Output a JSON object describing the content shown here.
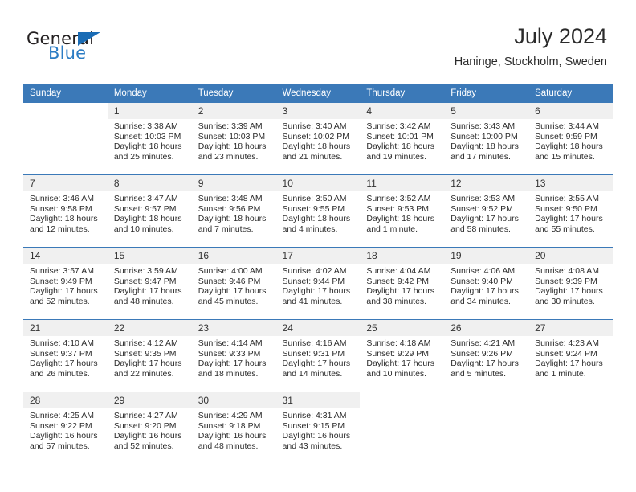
{
  "brand": {
    "name_dark": "General",
    "name_blue": "Blue",
    "accent_color": "#3b79b8"
  },
  "header": {
    "title": "July 2024",
    "subtitle": "Haninge, Stockholm, Sweden"
  },
  "calendar": {
    "weekday_headers": [
      "Sunday",
      "Monday",
      "Tuesday",
      "Wednesday",
      "Thursday",
      "Friday",
      "Saturday"
    ],
    "weeks": [
      [
        {
          "day": "",
          "sunrise": "",
          "sunset": "",
          "daylight1": "",
          "daylight2": ""
        },
        {
          "day": "1",
          "sunrise": "Sunrise: 3:38 AM",
          "sunset": "Sunset: 10:03 PM",
          "daylight1": "Daylight: 18 hours",
          "daylight2": "and 25 minutes."
        },
        {
          "day": "2",
          "sunrise": "Sunrise: 3:39 AM",
          "sunset": "Sunset: 10:03 PM",
          "daylight1": "Daylight: 18 hours",
          "daylight2": "and 23 minutes."
        },
        {
          "day": "3",
          "sunrise": "Sunrise: 3:40 AM",
          "sunset": "Sunset: 10:02 PM",
          "daylight1": "Daylight: 18 hours",
          "daylight2": "and 21 minutes."
        },
        {
          "day": "4",
          "sunrise": "Sunrise: 3:42 AM",
          "sunset": "Sunset: 10:01 PM",
          "daylight1": "Daylight: 18 hours",
          "daylight2": "and 19 minutes."
        },
        {
          "day": "5",
          "sunrise": "Sunrise: 3:43 AM",
          "sunset": "Sunset: 10:00 PM",
          "daylight1": "Daylight: 18 hours",
          "daylight2": "and 17 minutes."
        },
        {
          "day": "6",
          "sunrise": "Sunrise: 3:44 AM",
          "sunset": "Sunset: 9:59 PM",
          "daylight1": "Daylight: 18 hours",
          "daylight2": "and 15 minutes."
        }
      ],
      [
        {
          "day": "7",
          "sunrise": "Sunrise: 3:46 AM",
          "sunset": "Sunset: 9:58 PM",
          "daylight1": "Daylight: 18 hours",
          "daylight2": "and 12 minutes."
        },
        {
          "day": "8",
          "sunrise": "Sunrise: 3:47 AM",
          "sunset": "Sunset: 9:57 PM",
          "daylight1": "Daylight: 18 hours",
          "daylight2": "and 10 minutes."
        },
        {
          "day": "9",
          "sunrise": "Sunrise: 3:48 AM",
          "sunset": "Sunset: 9:56 PM",
          "daylight1": "Daylight: 18 hours",
          "daylight2": "and 7 minutes."
        },
        {
          "day": "10",
          "sunrise": "Sunrise: 3:50 AM",
          "sunset": "Sunset: 9:55 PM",
          "daylight1": "Daylight: 18 hours",
          "daylight2": "and 4 minutes."
        },
        {
          "day": "11",
          "sunrise": "Sunrise: 3:52 AM",
          "sunset": "Sunset: 9:53 PM",
          "daylight1": "Daylight: 18 hours",
          "daylight2": "and 1 minute."
        },
        {
          "day": "12",
          "sunrise": "Sunrise: 3:53 AM",
          "sunset": "Sunset: 9:52 PM",
          "daylight1": "Daylight: 17 hours",
          "daylight2": "and 58 minutes."
        },
        {
          "day": "13",
          "sunrise": "Sunrise: 3:55 AM",
          "sunset": "Sunset: 9:50 PM",
          "daylight1": "Daylight: 17 hours",
          "daylight2": "and 55 minutes."
        }
      ],
      [
        {
          "day": "14",
          "sunrise": "Sunrise: 3:57 AM",
          "sunset": "Sunset: 9:49 PM",
          "daylight1": "Daylight: 17 hours",
          "daylight2": "and 52 minutes."
        },
        {
          "day": "15",
          "sunrise": "Sunrise: 3:59 AM",
          "sunset": "Sunset: 9:47 PM",
          "daylight1": "Daylight: 17 hours",
          "daylight2": "and 48 minutes."
        },
        {
          "day": "16",
          "sunrise": "Sunrise: 4:00 AM",
          "sunset": "Sunset: 9:46 PM",
          "daylight1": "Daylight: 17 hours",
          "daylight2": "and 45 minutes."
        },
        {
          "day": "17",
          "sunrise": "Sunrise: 4:02 AM",
          "sunset": "Sunset: 9:44 PM",
          "daylight1": "Daylight: 17 hours",
          "daylight2": "and 41 minutes."
        },
        {
          "day": "18",
          "sunrise": "Sunrise: 4:04 AM",
          "sunset": "Sunset: 9:42 PM",
          "daylight1": "Daylight: 17 hours",
          "daylight2": "and 38 minutes."
        },
        {
          "day": "19",
          "sunrise": "Sunrise: 4:06 AM",
          "sunset": "Sunset: 9:40 PM",
          "daylight1": "Daylight: 17 hours",
          "daylight2": "and 34 minutes."
        },
        {
          "day": "20",
          "sunrise": "Sunrise: 4:08 AM",
          "sunset": "Sunset: 9:39 PM",
          "daylight1": "Daylight: 17 hours",
          "daylight2": "and 30 minutes."
        }
      ],
      [
        {
          "day": "21",
          "sunrise": "Sunrise: 4:10 AM",
          "sunset": "Sunset: 9:37 PM",
          "daylight1": "Daylight: 17 hours",
          "daylight2": "and 26 minutes."
        },
        {
          "day": "22",
          "sunrise": "Sunrise: 4:12 AM",
          "sunset": "Sunset: 9:35 PM",
          "daylight1": "Daylight: 17 hours",
          "daylight2": "and 22 minutes."
        },
        {
          "day": "23",
          "sunrise": "Sunrise: 4:14 AM",
          "sunset": "Sunset: 9:33 PM",
          "daylight1": "Daylight: 17 hours",
          "daylight2": "and 18 minutes."
        },
        {
          "day": "24",
          "sunrise": "Sunrise: 4:16 AM",
          "sunset": "Sunset: 9:31 PM",
          "daylight1": "Daylight: 17 hours",
          "daylight2": "and 14 minutes."
        },
        {
          "day": "25",
          "sunrise": "Sunrise: 4:18 AM",
          "sunset": "Sunset: 9:29 PM",
          "daylight1": "Daylight: 17 hours",
          "daylight2": "and 10 minutes."
        },
        {
          "day": "26",
          "sunrise": "Sunrise: 4:21 AM",
          "sunset": "Sunset: 9:26 PM",
          "daylight1": "Daylight: 17 hours",
          "daylight2": "and 5 minutes."
        },
        {
          "day": "27",
          "sunrise": "Sunrise: 4:23 AM",
          "sunset": "Sunset: 9:24 PM",
          "daylight1": "Daylight: 17 hours",
          "daylight2": "and 1 minute."
        }
      ],
      [
        {
          "day": "28",
          "sunrise": "Sunrise: 4:25 AM",
          "sunset": "Sunset: 9:22 PM",
          "daylight1": "Daylight: 16 hours",
          "daylight2": "and 57 minutes."
        },
        {
          "day": "29",
          "sunrise": "Sunrise: 4:27 AM",
          "sunset": "Sunset: 9:20 PM",
          "daylight1": "Daylight: 16 hours",
          "daylight2": "and 52 minutes."
        },
        {
          "day": "30",
          "sunrise": "Sunrise: 4:29 AM",
          "sunset": "Sunset: 9:18 PM",
          "daylight1": "Daylight: 16 hours",
          "daylight2": "and 48 minutes."
        },
        {
          "day": "31",
          "sunrise": "Sunrise: 4:31 AM",
          "sunset": "Sunset: 9:15 PM",
          "daylight1": "Daylight: 16 hours",
          "daylight2": "and 43 minutes."
        },
        {
          "day": "",
          "sunrise": "",
          "sunset": "",
          "daylight1": "",
          "daylight2": ""
        },
        {
          "day": "",
          "sunrise": "",
          "sunset": "",
          "daylight1": "",
          "daylight2": ""
        },
        {
          "day": "",
          "sunrise": "",
          "sunset": "",
          "daylight1": "",
          "daylight2": ""
        }
      ]
    ]
  }
}
